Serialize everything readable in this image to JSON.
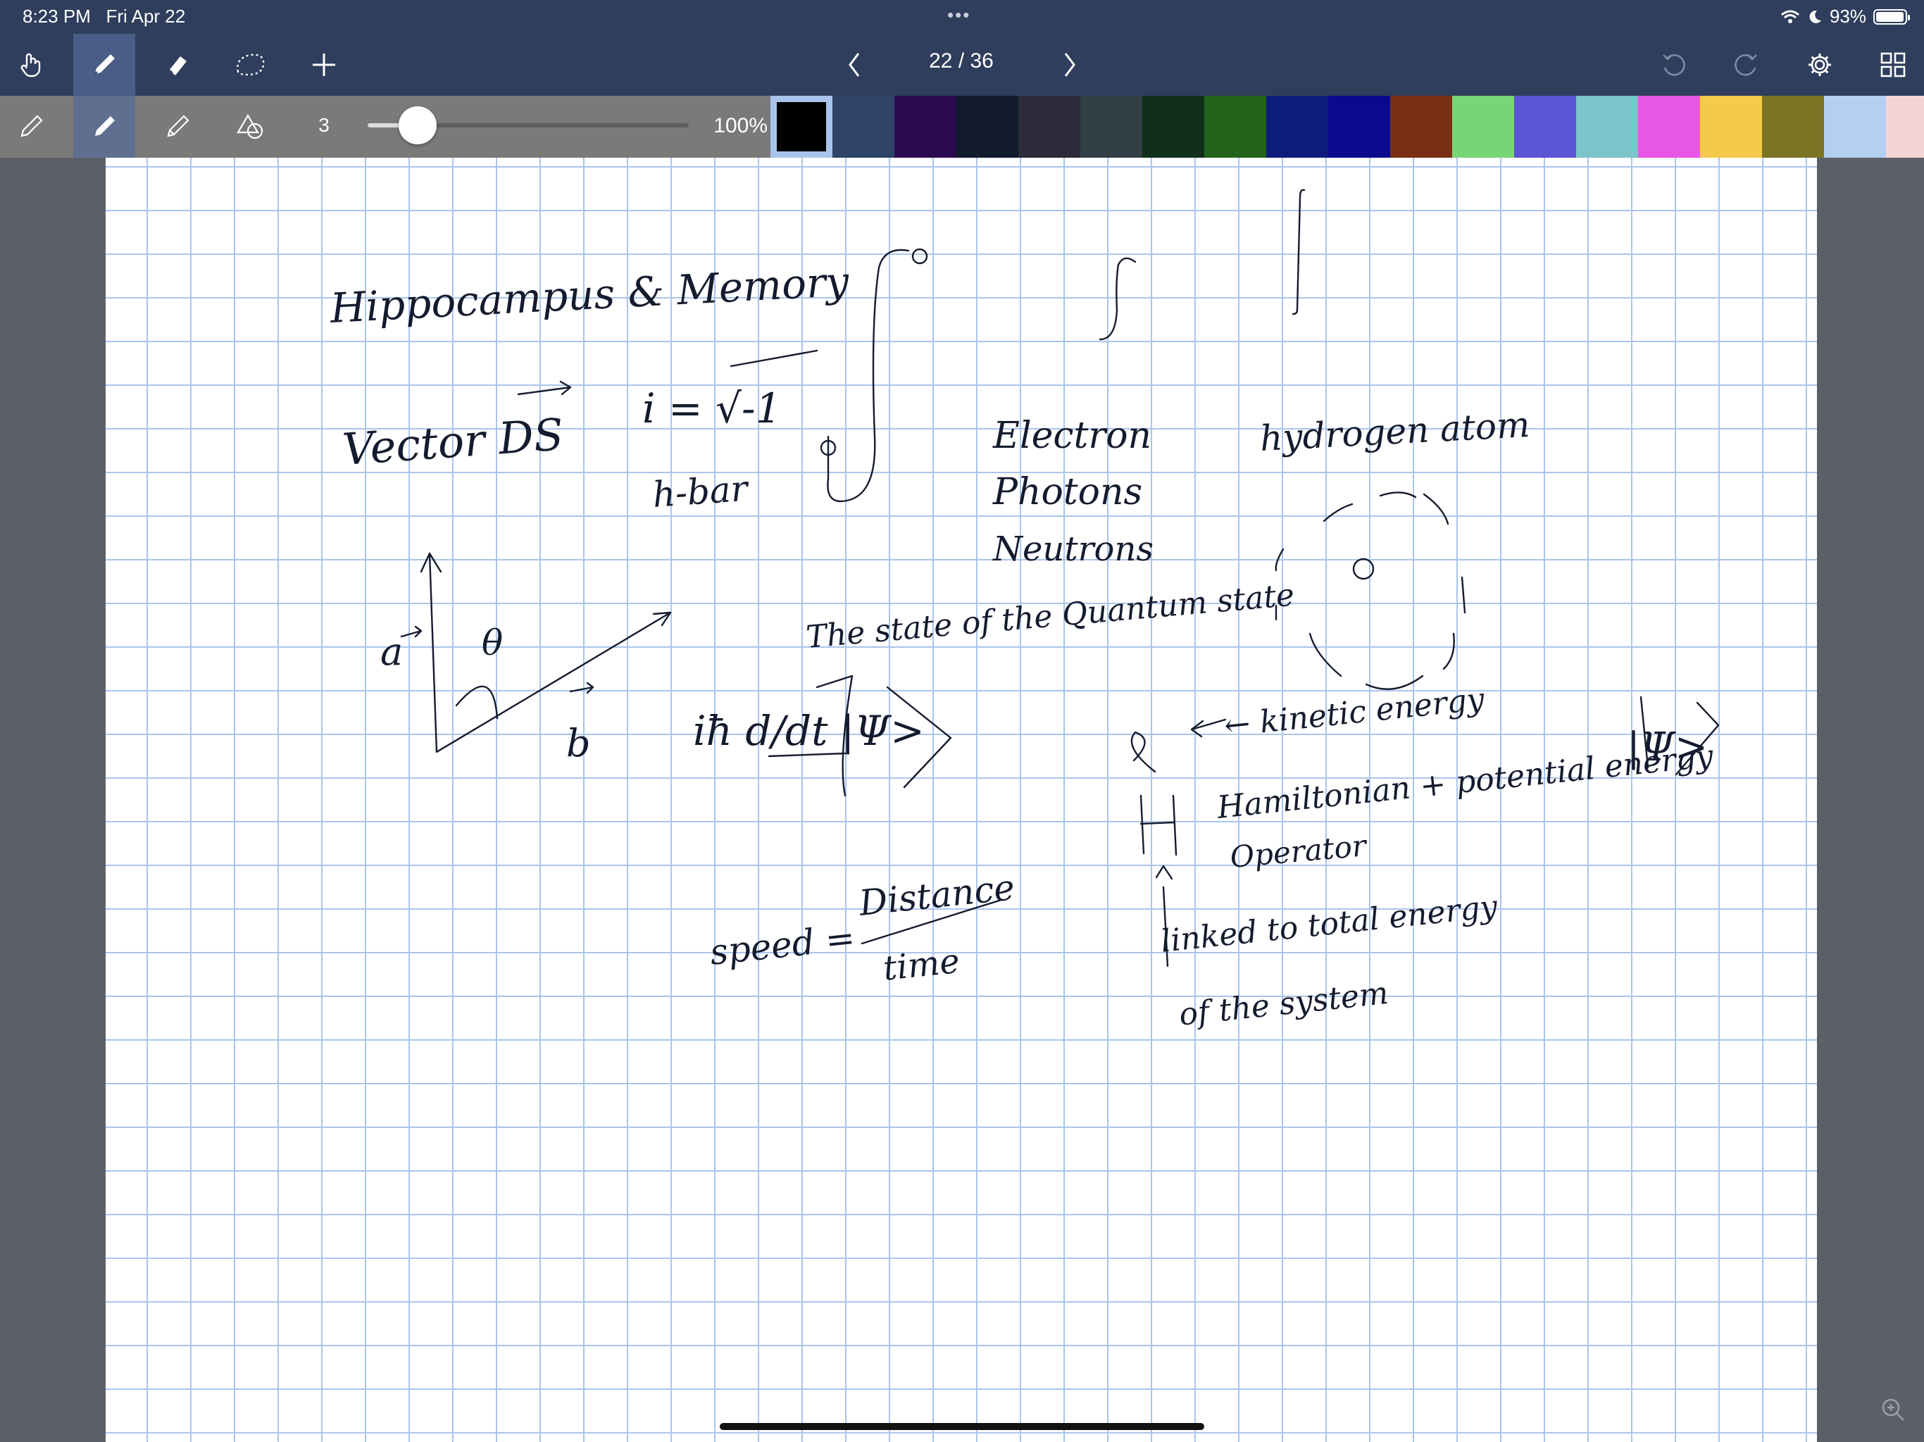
{
  "status": {
    "time": "8:23 PM",
    "date": "Fri Apr 22",
    "battery_pct": "93%",
    "battery_level": 0.93,
    "icons": [
      "wifi-icon",
      "moon-icon",
      "battery-icon"
    ]
  },
  "toolbar": {
    "page": "22 / 36",
    "left_tools": [
      "hand-icon",
      "pen-icon",
      "eraser-icon",
      "lasso-icon",
      "plus-icon"
    ],
    "right_tools": [
      "undo-icon",
      "redo-icon",
      "gear-icon",
      "grid-icon"
    ],
    "active_tool": "pen"
  },
  "pen_settings": {
    "size": "3",
    "zoom": "100%",
    "slider_level": 0.08,
    "tools": [
      "pencil-icon",
      "pen-icon",
      "highlighter-icon",
      "shapes-icon"
    ],
    "selected_color": "#000000",
    "colors": [
      "#000000",
      "#2e4468",
      "#2a0b4e",
      "#121b2c",
      "#2c2b3a",
      "#323f46",
      "#11301c",
      "#23641c",
      "#0e1c7b",
      "#0a0a8c",
      "#7a2f12",
      "#78d576",
      "#5b55d6",
      "#7cc4ca",
      "#e856e5",
      "#f5c94a",
      "#7a7424",
      "#b5cff2",
      "#f2d5d2"
    ]
  },
  "notes": {
    "title": "Hippocampus & Memory",
    "vector_label": "Vector DS",
    "i_equation": "i = √-1",
    "hbar": "h-bar",
    "particles": [
      "Electron",
      "Photons",
      "Neutrons"
    ],
    "atom_label": "hydrogen atom",
    "quantum_state": "The state of the Quantum state",
    "schrodinger_lhs": "iħ d/dt |Ψ>",
    "kinetic": "← kinetic energy",
    "hamiltonian": "Hamiltonian + potential energy",
    "operator": "Operator",
    "psi_ket": "|Ψ>",
    "total_energy": "linked to total energy",
    "system": "of the system",
    "speed_lhs": "speed =",
    "distance": "Distance",
    "time": "time",
    "vec_a": "a",
    "vec_b": "b",
    "theta": "θ"
  }
}
